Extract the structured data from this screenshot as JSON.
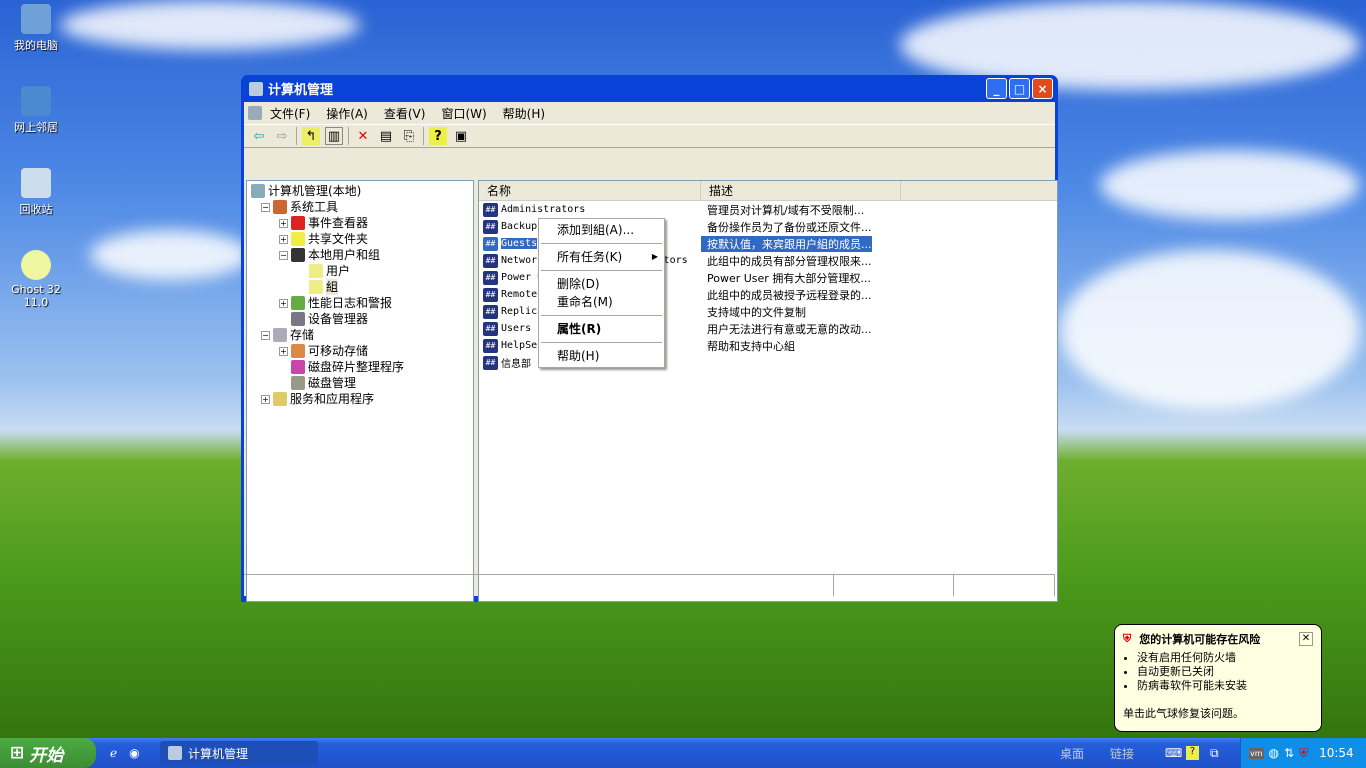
{
  "desktop": {
    "icons": [
      {
        "label": "我的电脑"
      },
      {
        "label": "网上邻居"
      },
      {
        "label": "回收站"
      },
      {
        "label": "Ghost 32 11.0"
      }
    ]
  },
  "window": {
    "title": "计算机管理",
    "minimize": "_",
    "maximize": "□",
    "close": "×"
  },
  "menubar": [
    "文件(F)",
    "操作(A)",
    "查看(V)",
    "窗口(W)",
    "帮助(H)"
  ],
  "tree": [
    {
      "label": "计算机管理(本地)",
      "level": 0
    },
    {
      "label": "系统工具",
      "level": 1,
      "toggle": "-"
    },
    {
      "label": "事件查看器",
      "level": 2,
      "toggle": "+"
    },
    {
      "label": "共享文件夹",
      "level": 2,
      "toggle": "+"
    },
    {
      "label": "本地用户和组",
      "level": 2,
      "toggle": "-"
    },
    {
      "label": "用户",
      "level": 3
    },
    {
      "label": "組",
      "level": 3,
      "selected": true
    },
    {
      "label": "性能日志和警报",
      "level": 2,
      "toggle": "+"
    },
    {
      "label": "设备管理器",
      "level": 2
    },
    {
      "label": "存储",
      "level": 1,
      "toggle": "-"
    },
    {
      "label": "可移动存储",
      "level": 2,
      "toggle": "+"
    },
    {
      "label": "磁盘碎片整理程序",
      "level": 2
    },
    {
      "label": "磁盘管理",
      "level": 2
    },
    {
      "label": "服务和应用程序",
      "level": 1,
      "toggle": "+"
    }
  ],
  "list": {
    "headers": [
      "名称",
      "描述"
    ],
    "rows": [
      {
        "name": "Administrators",
        "desc": "管理员对计算机/域有不受限制..."
      },
      {
        "name": "Backup Operators",
        "desc": "备份操作员为了备份或还原文件..."
      },
      {
        "name": "Guests",
        "desc": "按默认值，来宾跟用户組的成员...",
        "selected": true
      },
      {
        "name": "Network Configuration Operators",
        "desc": "此组中的成员有部分管理权限来..."
      },
      {
        "name": "Power Users",
        "desc": "Power User 拥有大部分管理权..."
      },
      {
        "name": "Remote Desktop Users",
        "desc": "此组中的成员被授予远程登录的..."
      },
      {
        "name": "Replicator",
        "desc": "支持域中的文件复制"
      },
      {
        "name": "Users",
        "desc": "用户无法进行有意或无意的改动..."
      },
      {
        "name": "HelpServicesGroup",
        "desc": "帮助和支持中心組"
      },
      {
        "name": "信息部",
        "desc": ""
      }
    ]
  },
  "context_menu": {
    "add_to_group": "添加到組(A)...",
    "all_tasks": "所有任务(K)",
    "delete": "删除(D)",
    "rename": "重命名(M)",
    "properties": "属性(R)",
    "help": "帮助(H)"
  },
  "balloon": {
    "title": "您的计算机可能存在风险",
    "items": [
      "没有启用任何防火墙",
      "自动更新已关闭",
      "防病毒软件可能未安装"
    ],
    "footer": "单击此气球修复该问题。"
  },
  "taskbar": {
    "start": "开始",
    "task": "计算机管理",
    "desktop_tb": "桌面",
    "links_tb": "链接",
    "clock": "10:54"
  }
}
